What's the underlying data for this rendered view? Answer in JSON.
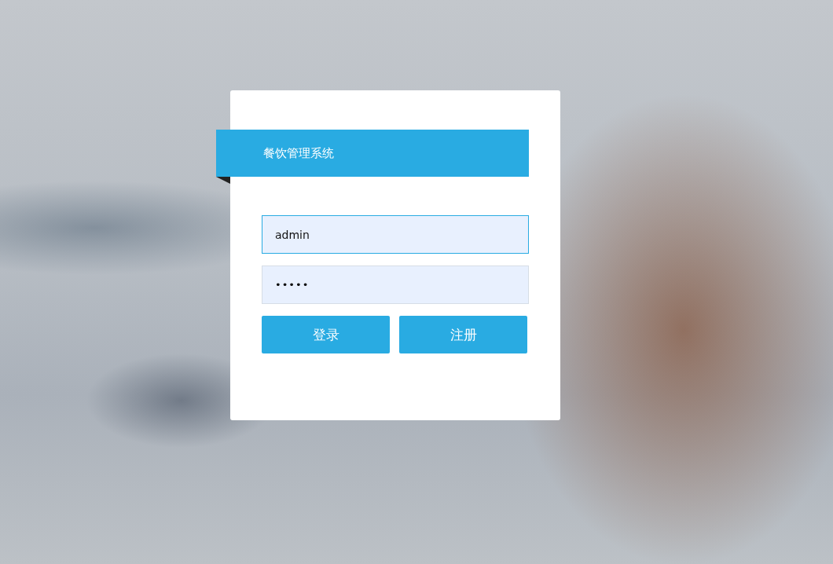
{
  "header": {
    "title": "餐饮管理系统"
  },
  "fields": [
    {
      "kind": "text",
      "value": "admin",
      "focused": true
    },
    {
      "kind": "password",
      "value": "•••••",
      "focused": false
    }
  ],
  "buttons": [
    {
      "label": "登录"
    },
    {
      "label": "注册"
    }
  ]
}
